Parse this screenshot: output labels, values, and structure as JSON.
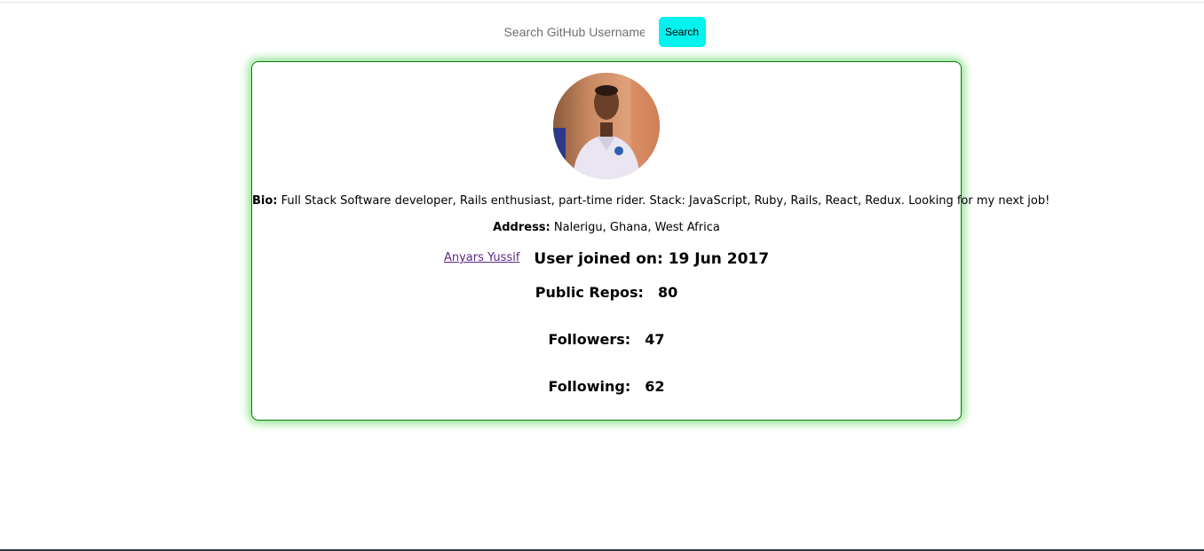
{
  "search": {
    "placeholder": "Search GitHub Username...",
    "button_label": "Search",
    "button_color": "#00f3ee"
  },
  "profile": {
    "avatar_icon": "user-photo-avatar",
    "bio_label": "Bio:",
    "bio": "Full Stack Software developer, Rails enthusiast, part-time rider. Stack: JavaScript, Ruby, Rails, React, Redux. Looking for my next job!",
    "address_label": "Address:",
    "address": "Nalerigu, Ghana, West Africa",
    "name_link": "Anyars Yussif",
    "joined": "User joined on: 19 Jun 2017",
    "public_repos_label": "Public Repos:",
    "public_repos": "80",
    "followers_label": "Followers:",
    "followers": "47",
    "following_label": "Following:",
    "following": "62"
  },
  "colors": {
    "card_border": "#0f7a0f",
    "card_glow": "#28c828",
    "link": "#5b2a86"
  }
}
